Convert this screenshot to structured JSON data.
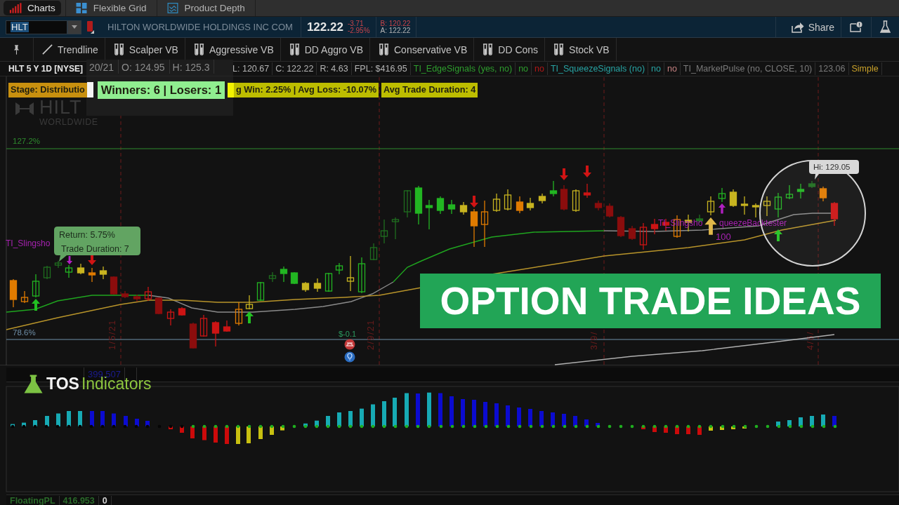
{
  "tabs": [
    {
      "label": "Charts",
      "selected": true
    },
    {
      "label": "Flexible Grid",
      "selected": false
    },
    {
      "label": "Product Depth",
      "selected": false
    }
  ],
  "symbol_bar": {
    "symbol": "HLT",
    "company": "HILTON WORLDWIDE HOLDINGS INC COM",
    "last": "122.22",
    "change": "-3.71",
    "change_percent": "-2.95%",
    "bid": "B: 120.22",
    "ask": "A: 122.22",
    "share": "Share"
  },
  "toolbar": [
    {
      "kind": "pin"
    },
    {
      "kind": "drawing",
      "label": "Trendline"
    },
    {
      "kind": "study",
      "label": "Scalper VB"
    },
    {
      "kind": "study",
      "label": "Aggressive VB"
    },
    {
      "kind": "study",
      "label": "DD Aggro VB"
    },
    {
      "kind": "study",
      "label": "Conservative VB"
    },
    {
      "kind": "study",
      "label": "DD Cons"
    },
    {
      "kind": "study",
      "label": "Stock VB"
    }
  ],
  "chart": {
    "title": "HLT 5 Y 1D [NYSE]",
    "popup": [
      "20/21",
      "O: 124.95",
      "H: 125.3"
    ],
    "values": [
      {
        "text": "L: 120.67",
        "color": "#b4b4b4"
      },
      {
        "text": "C: 122.22",
        "color": "#b4b4b4"
      },
      {
        "text": "R: 4.63",
        "color": "#b4b4b4"
      },
      {
        "text": "FPL: $416.95",
        "color": "#b4b4b4"
      },
      {
        "text": "TI_EdgeSignals (yes, no)",
        "color": "#2e9e2e"
      },
      {
        "text": "no",
        "color": "#2e9e2e"
      },
      {
        "text": "no",
        "color": "#b01818"
      },
      {
        "text": "TI_SqueezeSignals (no)",
        "color": "#27a3a3"
      },
      {
        "text": "no",
        "color": "#27a3a3"
      },
      {
        "text": "no",
        "color": "#c48080"
      },
      {
        "text": "TI_MarketPulse (no, CLOSE, 10)",
        "color": "#7a7a7a"
      },
      {
        "text": "123.06",
        "color": "#7a7a7a"
      },
      {
        "text": "Simple",
        "color": "#c9a12a"
      }
    ],
    "labels": [
      {
        "text": "Stage: Distributio",
        "color": "#c8900f",
        "kind": "standard"
      },
      {
        "text": "Winners: 6 | Losers: 1",
        "color": "#90ee90",
        "kind": "large"
      },
      {
        "text": "g Win: 2.25% | Avg Loss: -10.07%",
        "color": "#bdbd00",
        "kind": "standard"
      },
      {
        "text": "Avg Trade Duration: 4",
        "color": "#bdbd00",
        "kind": "standard"
      }
    ],
    "company_logo": {
      "name": "HILT",
      "tagline": "WORLDWIDE"
    },
    "levels": [
      {
        "label": "127.2%",
        "color": "#2e8b2e"
      },
      {
        "label": "78.6%",
        "color": "#6f8fa8"
      }
    ],
    "study_tag": "TI_Slingsho",
    "tooltip": [
      "Return: 5.75%",
      "Trade Duration: 7"
    ],
    "pl_marker": "$-0.1",
    "dates": [
      "1/5/21",
      "2/9/21",
      "3/9/",
      "4/6/"
    ],
    "backtester": {
      "label_parts": [
        "TI_Slingsho",
        "queezeBacktester"
      ],
      "value": "100"
    },
    "high_label": "Hi: 129.05"
  },
  "banner": "OPTION TRADE IDEAS",
  "subgraph": {
    "reading": "399.507"
  },
  "logo": {
    "brand": "TOS",
    "suffix": "Indicators"
  },
  "footer": [
    {
      "text": "FloatingPL",
      "color": "#2a6a2a"
    },
    {
      "text": "416.953",
      "color": "#2a6a2a"
    },
    {
      "text": "0",
      "color": "#d0d0d0"
    }
  ]
}
